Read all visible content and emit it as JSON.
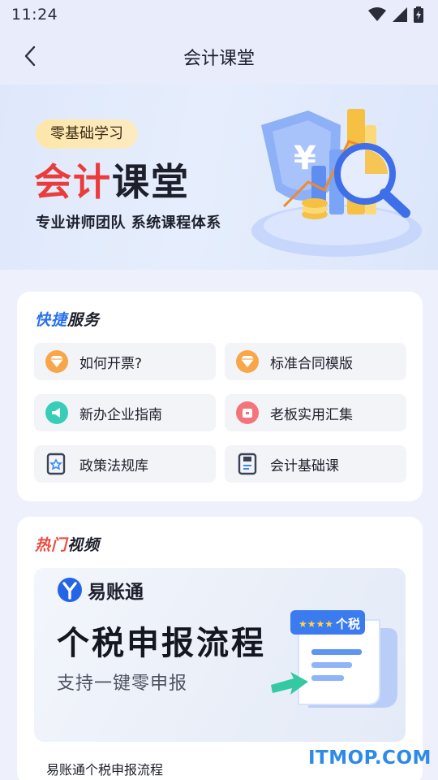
{
  "status": {
    "time": "11:24"
  },
  "header": {
    "title": "会计课堂"
  },
  "banner": {
    "badge": "零基础学习",
    "title_accent": "会计",
    "title_rest": "课堂",
    "subtitle": "专业讲师团队 系统课程体系"
  },
  "quick": {
    "title_a": "快捷",
    "title_b": "服务",
    "items": [
      {
        "label": "如何开票?",
        "icon": "gem-icon",
        "color": "#f59a3c"
      },
      {
        "label": "标准合同模版",
        "icon": "gem-icon",
        "color": "#f59a3c"
      },
      {
        "label": "新办企业指南",
        "icon": "megaphone-icon",
        "color": "#2ec7b5"
      },
      {
        "label": "老板实用汇集",
        "icon": "box-icon",
        "color": "#f2626a"
      },
      {
        "label": "政策法规库",
        "icon": "policy-doc-icon",
        "color": "#3b4256"
      },
      {
        "label": "会计基础课",
        "icon": "notebook-icon",
        "color": "#3b4256"
      }
    ]
  },
  "video": {
    "title_a": "热门",
    "title_b": "视频",
    "brand": "易账通",
    "thumb_title": "个税申报流程",
    "thumb_subtitle": "支持一键零申报",
    "thumb_tag": "个税",
    "caption": "易账通个税申报流程"
  },
  "watermark": "ITMOP.COM"
}
